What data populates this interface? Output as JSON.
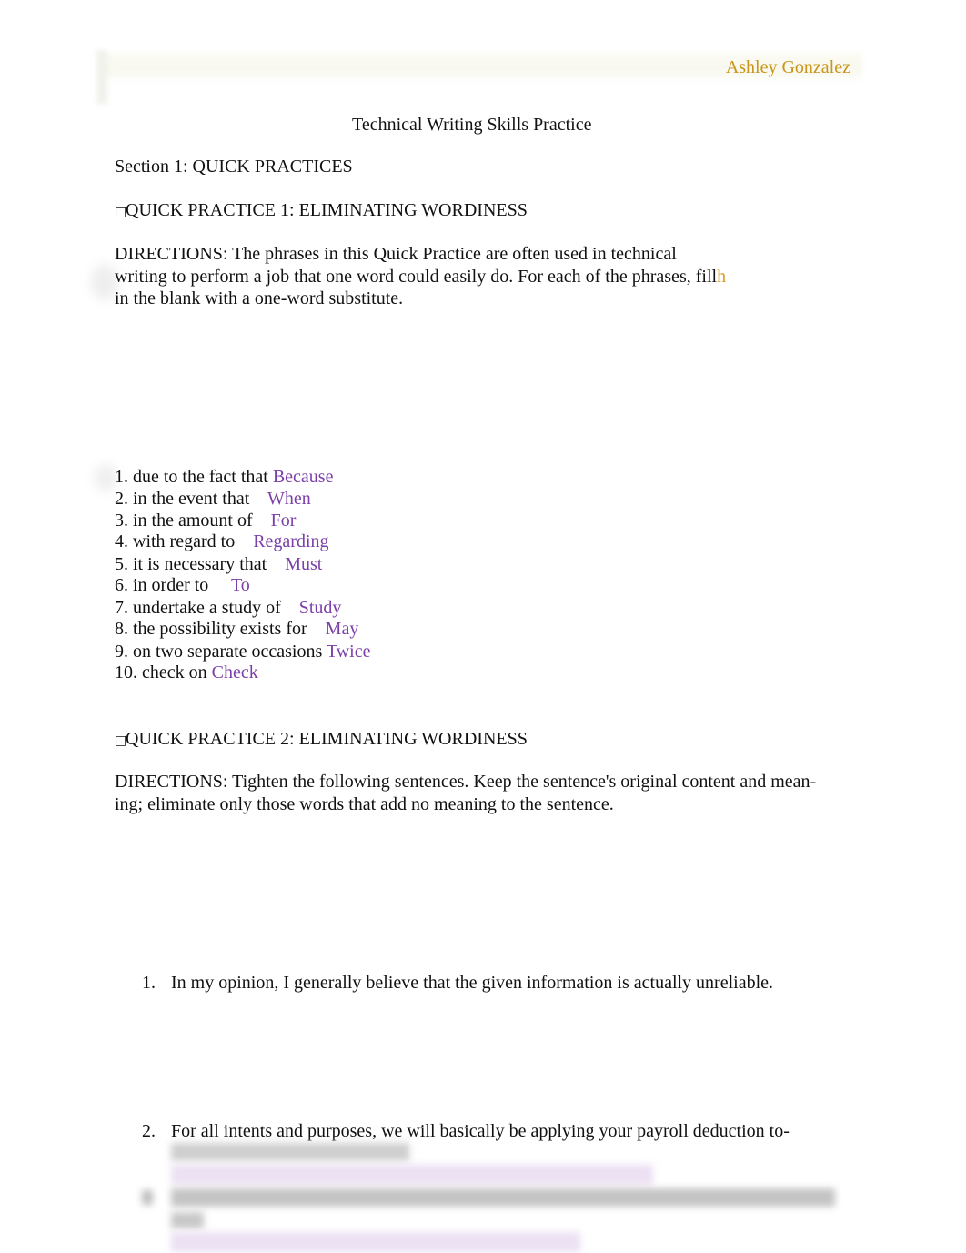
{
  "header": {
    "author": "Ashley Gonzalez"
  },
  "document": {
    "title": "Technical Writing Skills Practice",
    "section_heading": "Section 1: QUICK PRACTICES",
    "practice1": {
      "bullet_icon": "□",
      "heading": "QUICK PRACTICE 1: ELIMINATING WORDINESS",
      "directions_lines": [
        "DIRECTIONS: The phrases in this Quick Practice are often used in technical",
        "writing to perform a job that one word could easily do. For each of the phrases, fill",
        "in the blank with a one-word substitute."
      ],
      "directions_stray_char": "h",
      "items": [
        {
          "phrase": "1. due to the fact that",
          "answer": "Because"
        },
        {
          "phrase": "2. in the event that",
          "answer": "When"
        },
        {
          "phrase": "3. in the amount of",
          "answer": "For"
        },
        {
          "phrase": "4. with regard to",
          "answer": "Regarding"
        },
        {
          "phrase": "5. it is necessary that",
          "answer": "Must"
        },
        {
          "phrase": "6. in order to",
          "answer": "To"
        },
        {
          "phrase": "7. undertake a study of",
          "answer": "Study"
        },
        {
          "phrase": "8. the possibility exists for",
          "answer": "May"
        },
        {
          "phrase": "9. on two separate occasions",
          "answer": "Twice"
        },
        {
          "phrase": "10. check on",
          "answer": "Check"
        }
      ]
    },
    "practice2": {
      "bullet_icon": "□",
      "heading": "QUICK PRACTICE 2: ELIMINATING WORDINESS",
      "directions_lines": [
        "DIRECTIONS: Tighten the following sentences. Keep the sentence's original content and mean-",
        "ing; eliminate only those words that add no meaning to the sentence."
      ],
      "sentences": [
        {
          "number": "1.",
          "text": "In my opinion, I generally believe that the given information is actually unreliable."
        },
        {
          "number": "2.",
          "text": "For all intents and purposes, we will basically be applying your payroll deduction to-"
        }
      ]
    }
  }
}
